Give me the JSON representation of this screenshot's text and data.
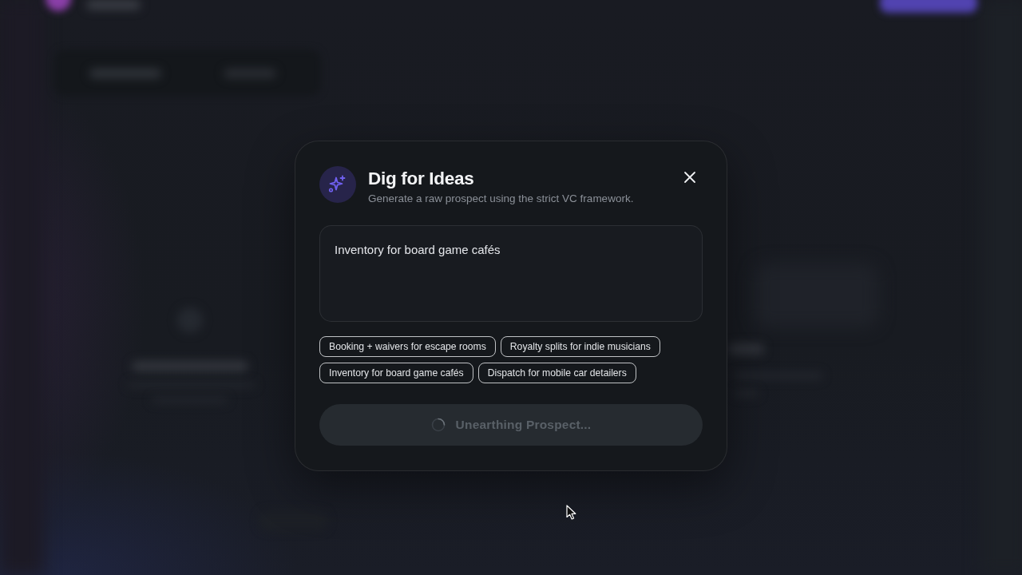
{
  "dialog": {
    "title": "Dig for Ideas",
    "subtitle": "Generate a raw prospect using the strict VC framework."
  },
  "prompt": {
    "value": "Inventory for board game cafés"
  },
  "suggestions": [
    "Booking + waivers for escape rooms",
    "Royalty splits for indie musicians",
    "Inventory for board game cafés",
    "Dispatch for mobile car detailers"
  ],
  "submit": {
    "label": "Unearthing Prospect...",
    "loading": true,
    "disabled": true
  }
}
